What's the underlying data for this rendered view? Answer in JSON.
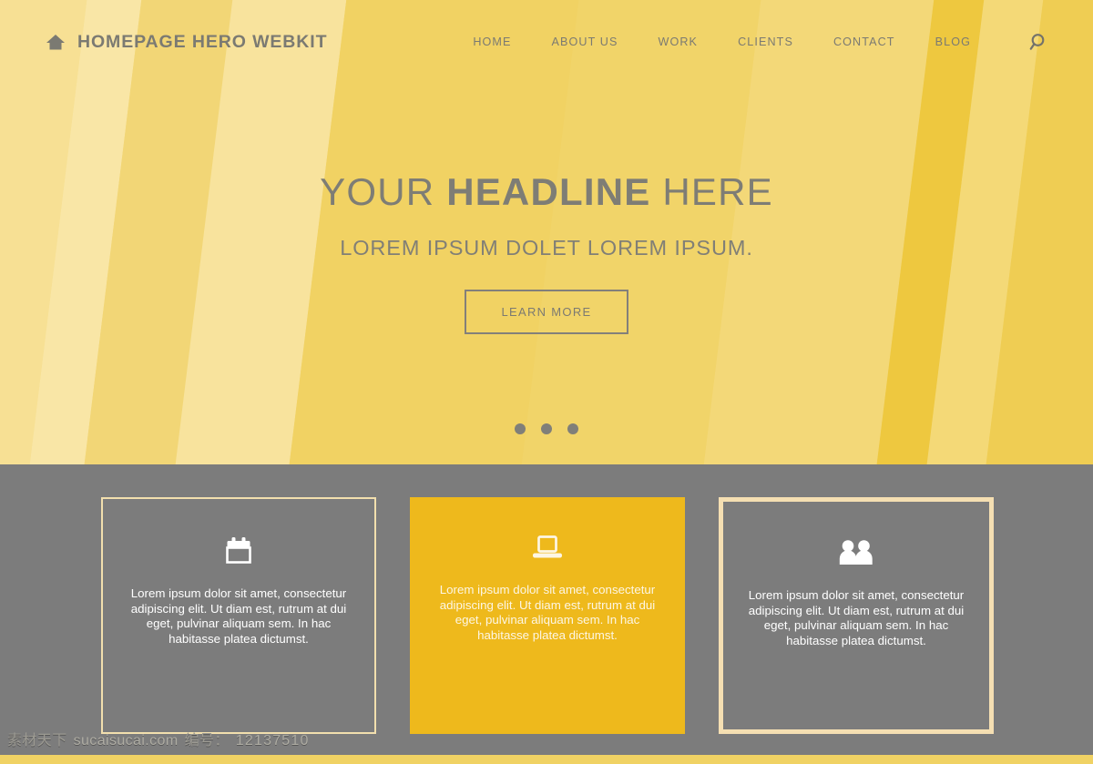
{
  "brand": {
    "title": "HOMEPAGE HERO WEBKIT",
    "home_icon": "home-icon"
  },
  "nav": {
    "items": [
      {
        "label": "HOME"
      },
      {
        "label": "ABOUT US"
      },
      {
        "label": "WORK"
      },
      {
        "label": "CLIENTS"
      },
      {
        "label": "CONTACT"
      },
      {
        "label": "BLOG"
      }
    ],
    "search_icon": "search-icon"
  },
  "hero": {
    "headline_prefix": "YOUR ",
    "headline_bold": "HEADLINE",
    "headline_suffix": " HERE",
    "subheadline": "LOREM IPSUM DOLET LOREM IPSUM.",
    "cta_label": "LEARN MORE",
    "carousel_dots": 3,
    "colors": {
      "base_light": "#f4da7f",
      "base_mid": "#f0d264",
      "base_dark": "#eec83f",
      "text": "#7e7d75"
    }
  },
  "cards": {
    "body_text": "Lorem ipsum dolor sit amet, consectetur adipiscing elit. Ut diam est, rutrum at dui eget, pulvinar aliquam sem. In hac habitasse platea dictumst.",
    "items": [
      {
        "icon": "calendar-icon",
        "style": "outlined-thin",
        "text": "Lorem ipsum dolor sit amet, consectetur adipiscing elit. Ut diam est, rutrum at dui eget, pulvinar aliquam sem. In hac habitasse platea dictumst."
      },
      {
        "icon": "laptop-icon",
        "style": "filled",
        "text": "Lorem ipsum dolor sit amet, consectetur adipiscing elit. Ut diam est, rutrum at dui eget, pulvinar aliquam sem. In hac habitasse platea dictumst."
      },
      {
        "icon": "users-icon",
        "style": "outlined-thick",
        "text": "Lorem ipsum dolor sit amet, consectetur adipiscing elit. Ut diam est, rutrum at dui eget, pulvinar aliquam sem. In hac habitasse platea dictumst."
      }
    ],
    "colors": {
      "section_bg": "#7c7c7c",
      "border": "#f2dfae",
      "filled_bg": "#eeb91c",
      "icon": "#ffffff"
    }
  },
  "watermark": {
    "site_cn": "素材天下",
    "site": "sucaisucai.com",
    "id_label": "编号：",
    "id_value": "12137510"
  }
}
